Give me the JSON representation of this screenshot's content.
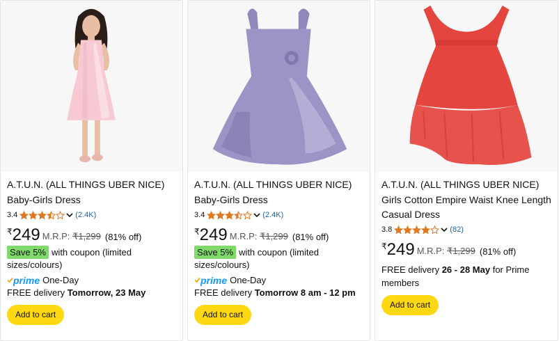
{
  "products": [
    {
      "brand": "A.T.U.N. (ALL THINGS UBER NICE)",
      "title": "Baby-Girls Dress",
      "rating": "3.4",
      "stars": 3.5,
      "reviews": "(2.4K)",
      "currency": "₹",
      "price": "249",
      "mrp_label": "M.R.P:",
      "mrp": "₹1,299",
      "discount": "(81% off)",
      "coupon_badge": "Save 5%",
      "coupon_text": "with coupon (limited sizes/colours)",
      "prime_label": "prime",
      "prime_text": "One-Day",
      "delivery_prefix": "FREE delivery",
      "delivery_date": "Tomorrow, 23 May",
      "delivery_suffix": "",
      "add_to_cart": "Add to cart",
      "dress_color": "#f6c9d3"
    },
    {
      "brand": "A.T.U.N. (ALL THINGS UBER NICE)",
      "title": "Baby-Girls Dress",
      "rating": "3.4",
      "stars": 3.5,
      "reviews": "(2.4K)",
      "currency": "₹",
      "price": "249",
      "mrp_label": "M.R.P:",
      "mrp": "₹1,299",
      "discount": "(81% off)",
      "coupon_badge": "Save 5%",
      "coupon_text": "with coupon (limited sizes/colours)",
      "prime_label": "prime",
      "prime_text": "One-Day",
      "delivery_prefix": "FREE delivery",
      "delivery_date": "Tomorrow 8 am - 12 pm",
      "delivery_suffix": "",
      "add_to_cart": "Add to cart",
      "dress_color": "#9b95c6"
    },
    {
      "brand": "A.T.U.N. (ALL THINGS UBER NICE)",
      "title": "Girls Cotton Empire Waist Knee Length Casual Dress",
      "rating": "3.8",
      "stars": 4,
      "reviews": "(82)",
      "currency": "₹",
      "price": "249",
      "mrp_label": "M.R.P:",
      "mrp": "₹1,299",
      "discount": "(81% off)",
      "delivery_prefix": "FREE delivery",
      "delivery_date": "26 - 28 May",
      "delivery_suffix": "for Prime members",
      "add_to_cart": "Add to cart",
      "dress_color": "#e4453f"
    }
  ],
  "colors": {
    "star": "#de7921",
    "link": "#2162a1",
    "prime": "#1399ff",
    "button": "#ffd814",
    "coupon_badge": "#7fda69"
  }
}
